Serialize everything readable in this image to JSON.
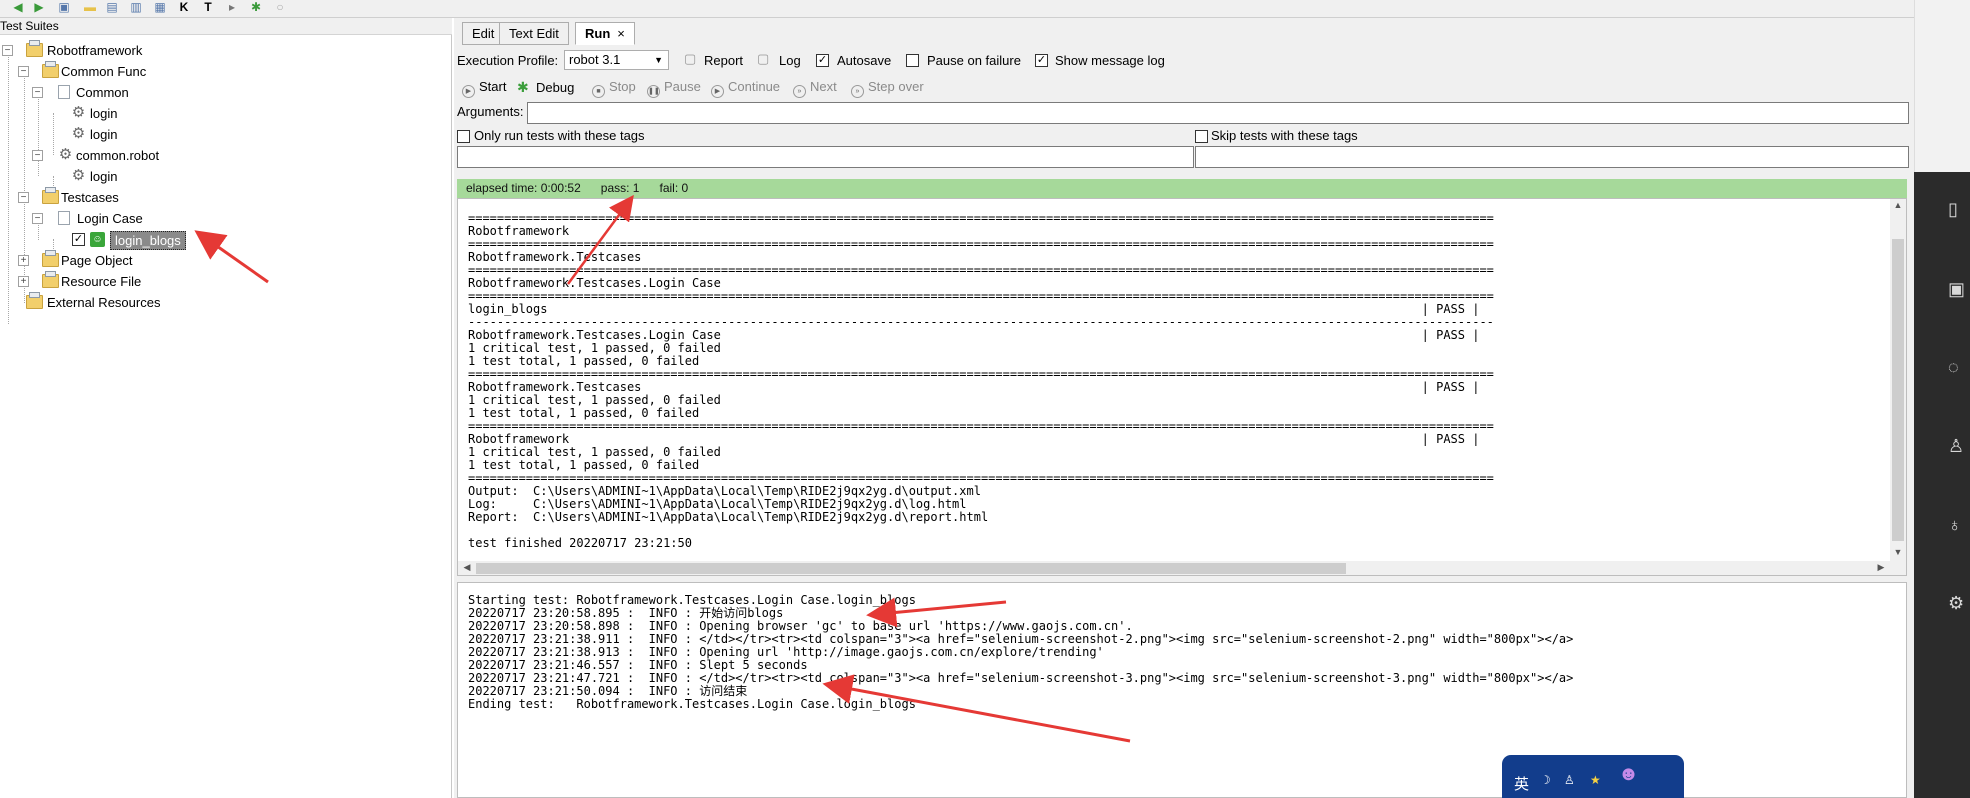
{
  "tree": {
    "header": "Test Suites",
    "nodes": [
      {
        "label": "Robotframework"
      },
      {
        "label": "Common Func"
      },
      {
        "label": "Common"
      },
      {
        "label": "login"
      },
      {
        "label": "login"
      },
      {
        "label": "common.robot"
      },
      {
        "label": "login"
      },
      {
        "label": "Testcases"
      },
      {
        "label": "Login Case"
      },
      {
        "label": "login_blogs"
      },
      {
        "label": "Page Object"
      },
      {
        "label": "Resource File"
      },
      {
        "label": "External Resources"
      }
    ]
  },
  "tabs": [
    {
      "label": "Edit"
    },
    {
      "label": "Text Edit"
    },
    {
      "label": "Run",
      "close": "×"
    }
  ],
  "run": {
    "profile_label": "Execution Profile:",
    "profile_value": "robot 3.1",
    "options": {
      "report": "Report",
      "log": "Log",
      "autosave": "Autosave",
      "pause_on_failure": "Pause on failure",
      "show_message_log": "Show message log"
    },
    "buttons": {
      "start": "Start",
      "debug": "Debug",
      "stop": "Stop",
      "pause": "Pause",
      "continue": "Continue",
      "next": "Next",
      "step_over": "Step over"
    },
    "arguments_label": "Arguments:",
    "only_run_label": "Only run tests with these tags",
    "skip_label": "Skip tests with these tags",
    "status": {
      "elapsed": "elapsed time: 0:00:52",
      "pass": "pass: 1",
      "fail": "fail: 0"
    }
  },
  "output_console": [
    "==============================================================================================================================================",
    "Robotframework",
    "==============================================================================================================================================",
    "Robotframework.Testcases",
    "==============================================================================================================================================",
    "Robotframework.Testcases.Login Case",
    "==============================================================================================================================================",
    "login_blogs                                                                                                                         | PASS |",
    "----------------------------------------------------------------------------------------------------------------------------------------------",
    "Robotframework.Testcases.Login Case                                                                                                 | PASS |",
    "1 critical test, 1 passed, 0 failed",
    "1 test total, 1 passed, 0 failed",
    "==============================================================================================================================================",
    "Robotframework.Testcases                                                                                                            | PASS |",
    "1 critical test, 1 passed, 0 failed",
    "1 test total, 1 passed, 0 failed",
    "==============================================================================================================================================",
    "Robotframework                                                                                                                      | PASS |",
    "1 critical test, 1 passed, 0 failed",
    "1 test total, 1 passed, 0 failed",
    "==============================================================================================================================================",
    "Output:  C:\\Users\\ADMINI~1\\AppData\\Local\\Temp\\RIDE2j9qx2yg.d\\output.xml",
    "Log:     C:\\Users\\ADMINI~1\\AppData\\Local\\Temp\\RIDE2j9qx2yg.d\\log.html",
    "Report:  C:\\Users\\ADMINI~1\\AppData\\Local\\Temp\\RIDE2j9qx2yg.d\\report.html",
    "",
    "test finished 20220717 23:21:50"
  ],
  "message_log": [
    "Starting test: Robotframework.Testcases.Login Case.login_blogs",
    "20220717 23:20:58.895 :  INFO : 开始访问blogs",
    "20220717 23:20:58.898 :  INFO : Opening browser 'gc' to base url 'https://www.gaojs.com.cn'.",
    "20220717 23:21:38.911 :  INFO : </td></tr><tr><td colspan=\"3\"><a href=\"selenium-screenshot-2.png\"><img src=\"selenium-screenshot-2.png\" width=\"800px\"></a>",
    "20220717 23:21:38.913 :  INFO : Opening url 'http://image.gaojs.com.cn/explore/trending'",
    "20220717 23:21:46.557 :  INFO : Slept 5 seconds",
    "20220717 23:21:47.721 :  INFO : </td></tr><tr><td colspan=\"3\"><a href=\"selenium-screenshot-3.png\"><img src=\"selenium-screenshot-3.png\" width=\"800px\"></a>",
    "20220717 23:21:50.094 :  INFO : 访问结束",
    "Ending test:   Robotframework.Testcases.Login Case.login_blogs"
  ],
  "ime_widget": {
    "label": "英"
  },
  "icons": {
    "dock": [
      "book-icon",
      "image-icon",
      "chat-icon",
      "shirt-icon",
      "user-icon",
      "settings-icon"
    ]
  },
  "colors": {
    "status_bar": "#a6d99a",
    "folder": "#f2cf6b",
    "annotation_arrow": "#e53935",
    "dock": "#2b2b2b",
    "ime": "#123d8c"
  }
}
